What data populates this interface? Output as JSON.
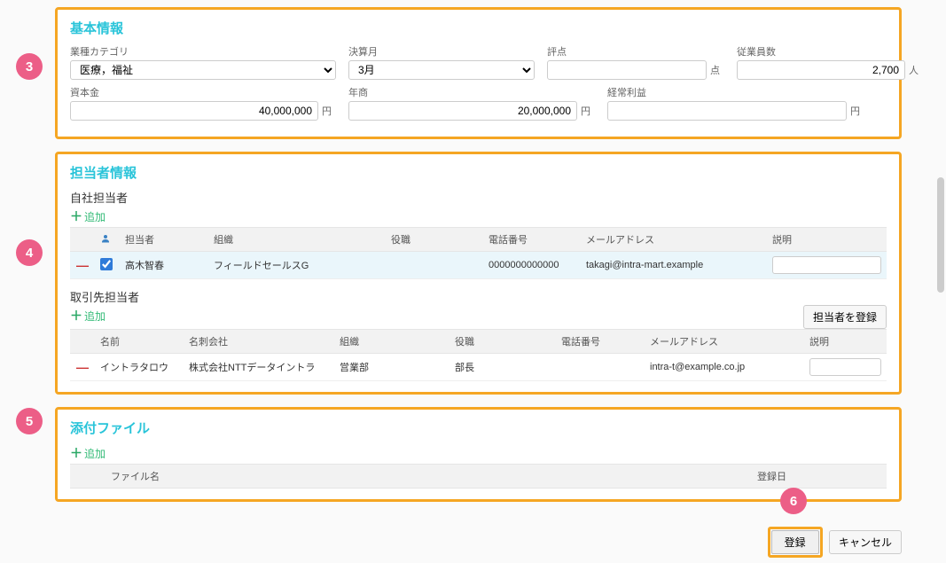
{
  "badges": {
    "b3": "3",
    "b4": "4",
    "b5": "5",
    "b6": "6"
  },
  "basic": {
    "title": "基本情報",
    "category_label": "業種カテゴリ",
    "category_value": "医療，福祉",
    "month_label": "決算月",
    "month_value": "3月",
    "score_label": "評点",
    "score_value": "",
    "score_unit": "点",
    "emp_label": "従業員数",
    "emp_value": "2,700",
    "emp_unit": "人",
    "capital_label": "資本金",
    "capital_value": "40,000,000",
    "sales_label": "年商",
    "sales_value": "20,000,000",
    "profit_label": "経常利益",
    "profit_value": "",
    "yen": "円"
  },
  "contact": {
    "title": "担当者情報",
    "own_title": "自社担当者",
    "add_label": "追加",
    "register_contact_btn": "担当者を登録",
    "own_headers": {
      "person": "担当者",
      "org": "組織",
      "role": "役職",
      "phone": "電話番号",
      "email": "メールアドレス",
      "desc": "説明"
    },
    "own_row": {
      "name": "高木智春",
      "org": "フィールドセールスG",
      "role": "",
      "phone": "0000000000000",
      "email": "takagi@intra-mart.example",
      "desc": ""
    },
    "partner_title": "取引先担当者",
    "partner_headers": {
      "name": "名前",
      "company": "名刺会社",
      "org": "組織",
      "role": "役職",
      "phone": "電話番号",
      "email": "メールアドレス",
      "desc": "説明"
    },
    "partner_row": {
      "name": "イントラタロウ",
      "company": "株式会社NTTデータイントラ",
      "org": "営業部",
      "role": "部長",
      "phone": "",
      "email": "intra-t@example.co.jp",
      "desc": ""
    }
  },
  "attach": {
    "title": "添付ファイル",
    "add_label": "追加",
    "file_header": "ファイル名",
    "date_header": "登録日"
  },
  "footer": {
    "register": "登録",
    "cancel": "キャンセル"
  }
}
